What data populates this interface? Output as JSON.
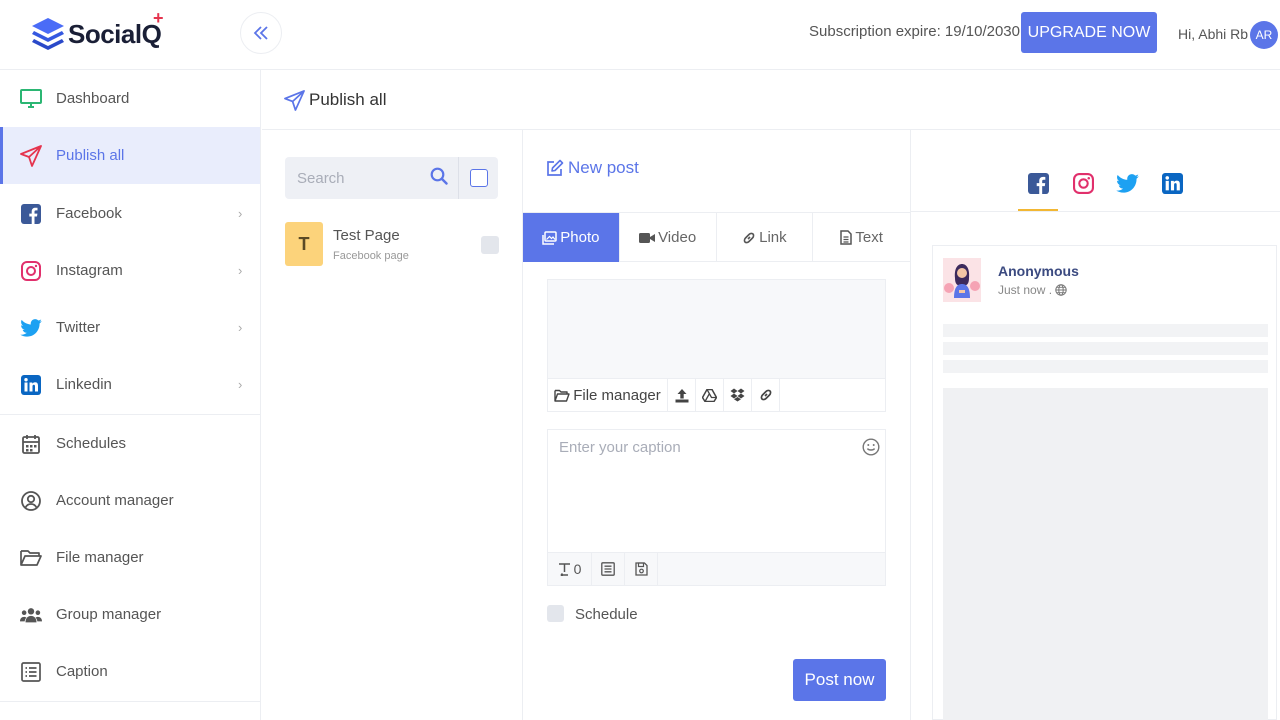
{
  "app": {
    "brand": "SocialQ",
    "brand_plus": "+",
    "subscription_text": "Subscription expire: 19/10/2030",
    "upgrade_label": "UPGRADE NOW",
    "greeting": "Hi, Abhi Rb",
    "avatar_initials": "AR"
  },
  "sidebar": {
    "items": [
      {
        "label": "Dashboard",
        "icon": "monitor-icon"
      },
      {
        "label": "Publish all",
        "icon": "paper-plane-icon",
        "active": true
      },
      {
        "label": "Facebook",
        "icon": "facebook-icon",
        "chevron": true
      },
      {
        "label": "Instagram",
        "icon": "instagram-icon",
        "chevron": true
      },
      {
        "label": "Twitter",
        "icon": "twitter-icon",
        "chevron": true
      },
      {
        "label": "Linkedin",
        "icon": "linkedin-icon",
        "chevron": true
      },
      {
        "label": "Schedules",
        "icon": "calendar-icon"
      },
      {
        "label": "Account manager",
        "icon": "user-circle-icon"
      },
      {
        "label": "File manager",
        "icon": "folder-icon"
      },
      {
        "label": "Group manager",
        "icon": "users-icon"
      },
      {
        "label": "Caption",
        "icon": "list-icon"
      }
    ]
  },
  "page": {
    "title": "Publish all"
  },
  "accounts": {
    "search_placeholder": "Search",
    "items": [
      {
        "initial": "T",
        "name": "Test Page",
        "type": "Facebook page"
      }
    ]
  },
  "composer": {
    "title": "New post",
    "tabs": [
      {
        "label": "Photo",
        "icon": "photo-icon",
        "active": true
      },
      {
        "label": "Video",
        "icon": "video-icon"
      },
      {
        "label": "Link",
        "icon": "link-icon"
      },
      {
        "label": "Text",
        "icon": "file-text-icon"
      }
    ],
    "media_tools": {
      "file_manager": "File manager"
    },
    "caption_placeholder": "Enter your caption",
    "char_count": "0",
    "schedule_label": "Schedule",
    "post_button": "Post now"
  },
  "preview": {
    "networks": [
      "facebook-icon",
      "instagram-icon",
      "twitter-icon",
      "linkedin-icon"
    ],
    "active_network": "facebook",
    "name": "Anonymous",
    "time": "Just now ."
  },
  "colors": {
    "accent": "#5b75e8",
    "facebook": "#3b5998",
    "instagram": "#e1306c",
    "twitter": "#1da1f2",
    "linkedin": "#0a66c2",
    "tab_underline": "#f2b733"
  }
}
